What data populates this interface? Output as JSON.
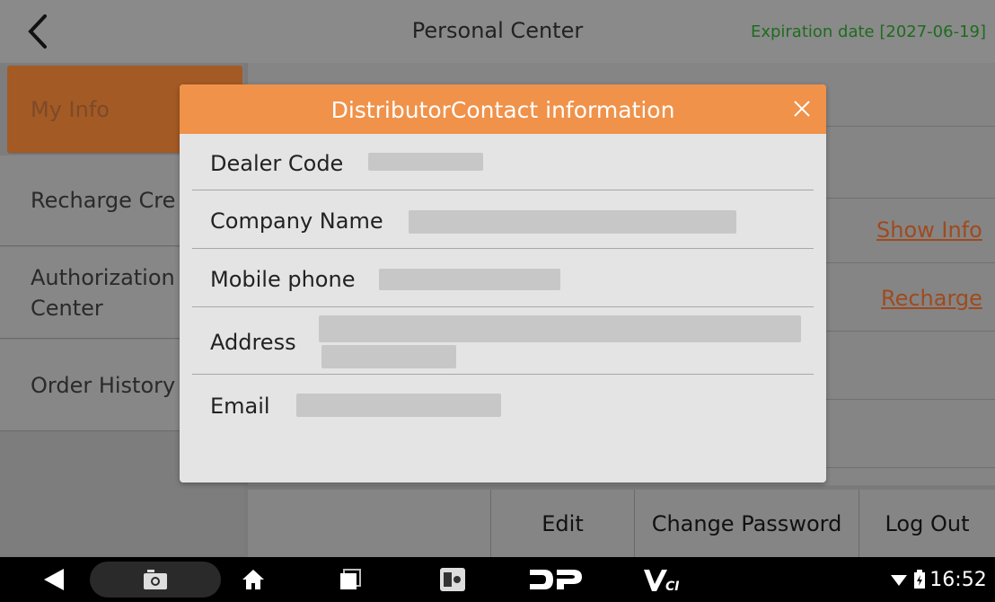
{
  "header": {
    "title": "Personal Center",
    "expiration": "Expiration date [2027-06-19]"
  },
  "sidebar": {
    "items": [
      {
        "label": "My Info"
      },
      {
        "label": "Recharge Cre"
      },
      {
        "label": "Authorization Center"
      },
      {
        "label": "Order History"
      }
    ]
  },
  "main": {
    "show_info_link": "Show Info",
    "recharge_link": "Recharge"
  },
  "actions": {
    "edit": "Edit",
    "change_password": "Change Password",
    "log_out": "Log Out"
  },
  "dialog": {
    "title": "DistributorContact information",
    "fields": [
      {
        "label": "Dealer Code"
      },
      {
        "label": "Company Name"
      },
      {
        "label": "Mobile phone"
      },
      {
        "label": "Address"
      },
      {
        "label": "Email"
      }
    ]
  },
  "navbar": {
    "time": "16:52",
    "icons": [
      "back-icon",
      "screenshot-icon",
      "home-icon",
      "recents-icon",
      "app-icon",
      "dp-logo",
      "vci-logo",
      "wifi-icon",
      "battery-icon"
    ]
  },
  "colors": {
    "accent": "#f0924a",
    "link": "#a04a1e",
    "expiration": "#1e6b1e"
  }
}
